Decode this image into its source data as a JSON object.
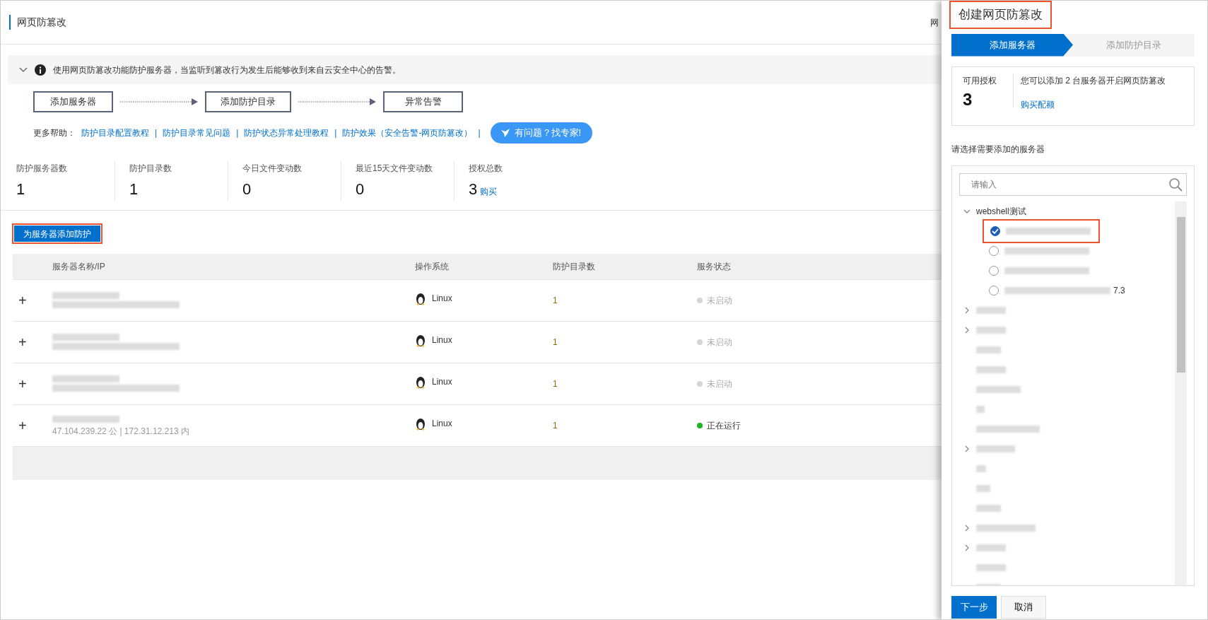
{
  "page": {
    "title": "网页防篡改",
    "header_cut_text": "网"
  },
  "notice": {
    "expanded": true,
    "text": "使用网页防篡改功能防护服务器，当监听到篡改行为发生后能够收到来自云安全中心的告警。"
  },
  "flow_steps": [
    "添加服务器",
    "添加防护目录",
    "异常告警"
  ],
  "help": {
    "label": "更多帮助：",
    "separator": "|",
    "links": [
      "防护目录配置教程",
      "防护目录常见问题",
      "防护状态异常处理教程",
      "防护效果（安全告警-网页防篡改）"
    ],
    "expert_button": "有问题？找专家!"
  },
  "stats": [
    {
      "label": "防护服务器数",
      "value": "1"
    },
    {
      "label": "防护目录数",
      "value": "1"
    },
    {
      "label": "今日文件变动数",
      "value": "0"
    },
    {
      "label": "最近15天文件变动数",
      "value": "0"
    },
    {
      "label": "授权总数",
      "value": "3",
      "link": "购买"
    }
  ],
  "add_button": {
    "label": "为服务器添加防护",
    "highlighted": true
  },
  "table": {
    "columns": [
      "服务器名称/IP",
      "操作系统",
      "防护目录数",
      "服务状态"
    ],
    "rows": [
      {
        "expand": "+",
        "os": "Linux",
        "dirs": "1",
        "status": "未启动",
        "running": false
      },
      {
        "expand": "+",
        "os": "Linux",
        "dirs": "1",
        "status": "未启动",
        "running": false
      },
      {
        "expand": "+",
        "os": "Linux",
        "dirs": "1",
        "status": "未启动",
        "running": false
      },
      {
        "expand": "+",
        "ip": "47.104.239.22 公 | 172.31.12.213 内",
        "os": "Linux",
        "dirs": "1",
        "status": "正在运行",
        "running": true
      }
    ]
  },
  "drawer": {
    "title": "创建网页防篡改",
    "title_highlighted": true,
    "steps": [
      {
        "label": "添加服务器",
        "selected": true
      },
      {
        "label": "添加防护目录",
        "selected": false
      }
    ],
    "quota": {
      "label": "可用授权",
      "value": "3",
      "message": "您可以添加 2 台服务器开启网页防篡改",
      "link": "购买配额"
    },
    "select_label": "请选择需要添加的服务器",
    "search": {
      "placeholder": "请输入"
    },
    "tree": [
      {
        "kind": "group",
        "label": "webshell测试",
        "expanded": true,
        "children": [
          {
            "kind": "server",
            "selected": true,
            "highlighted": true
          },
          {
            "kind": "server",
            "selected": false
          },
          {
            "kind": "server",
            "selected": false
          },
          {
            "kind": "server",
            "selected": false,
            "suffix": "7.3"
          }
        ]
      },
      {
        "kind": "group",
        "expanded": false
      },
      {
        "kind": "group",
        "expanded": false
      },
      {
        "kind": "leaf"
      },
      {
        "kind": "leaf"
      },
      {
        "kind": "leaf"
      },
      {
        "kind": "leaf"
      },
      {
        "kind": "leaf"
      },
      {
        "kind": "group",
        "expanded": false
      },
      {
        "kind": "leaf"
      },
      {
        "kind": "leaf"
      },
      {
        "kind": "leaf"
      },
      {
        "kind": "group",
        "expanded": false
      },
      {
        "kind": "group",
        "expanded": false
      },
      {
        "kind": "leaf"
      },
      {
        "kind": "leaf"
      }
    ],
    "buttons": [
      {
        "label": "下一步",
        "kind": "primary"
      },
      {
        "label": "取消",
        "kind": "secondary"
      }
    ]
  }
}
